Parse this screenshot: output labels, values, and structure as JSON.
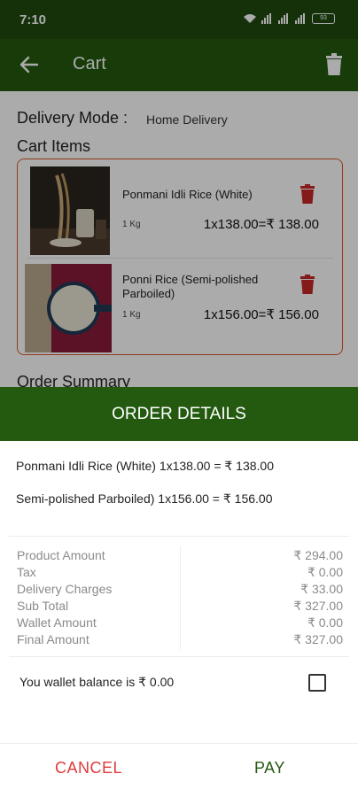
{
  "status_bar": {
    "time": "7:10",
    "battery": "93"
  },
  "app_bar": {
    "title": "Cart"
  },
  "page": {
    "delivery_mode_label": "Delivery Mode :",
    "delivery_mode_value": "Home Delivery",
    "cart_items_label": "Cart Items",
    "order_summary_label": "Order Summary",
    "items": [
      {
        "name": "Ponmani Idli Rice (White)",
        "unit": "1 Kg",
        "price": "1x138.00=₹ 138.00"
      },
      {
        "name": "Ponni Rice (Semi-polished Parboiled)",
        "unit": "1 Kg",
        "price": "1x156.00=₹ 156.00"
      }
    ]
  },
  "order_details": {
    "title": "ORDER DETAILS",
    "lines": [
      "Ponmani Idli Rice (White)  1x138.00 = ₹ 138.00",
      "Semi-polished Parboiled)  1x156.00 = ₹ 156.00"
    ],
    "summary": [
      {
        "label": "Product Amount",
        "value": "₹ 294.00"
      },
      {
        "label": "Tax",
        "value": "₹ 0.00"
      },
      {
        "label": "Delivery Charges",
        "value": "₹ 33.00"
      },
      {
        "label": "Sub Total",
        "value": "₹ 327.00"
      },
      {
        "label": "Wallet Amount",
        "value": "₹ 0.00"
      },
      {
        "label": "Final Amount",
        "value": "₹ 327.00"
      }
    ],
    "wallet_text": "You wallet balance is ₹ 0.00",
    "cancel_label": "CANCEL",
    "pay_label": "PAY"
  },
  "colors": {
    "primary_green": "#235a10",
    "cancel_red": "#e03a3a",
    "delete_red": "#c62828",
    "cart_border": "#d9582c"
  },
  "icons": [
    "back-arrow-icon",
    "trash-icon",
    "wifi-icon",
    "signal-icon",
    "battery-icon"
  ]
}
